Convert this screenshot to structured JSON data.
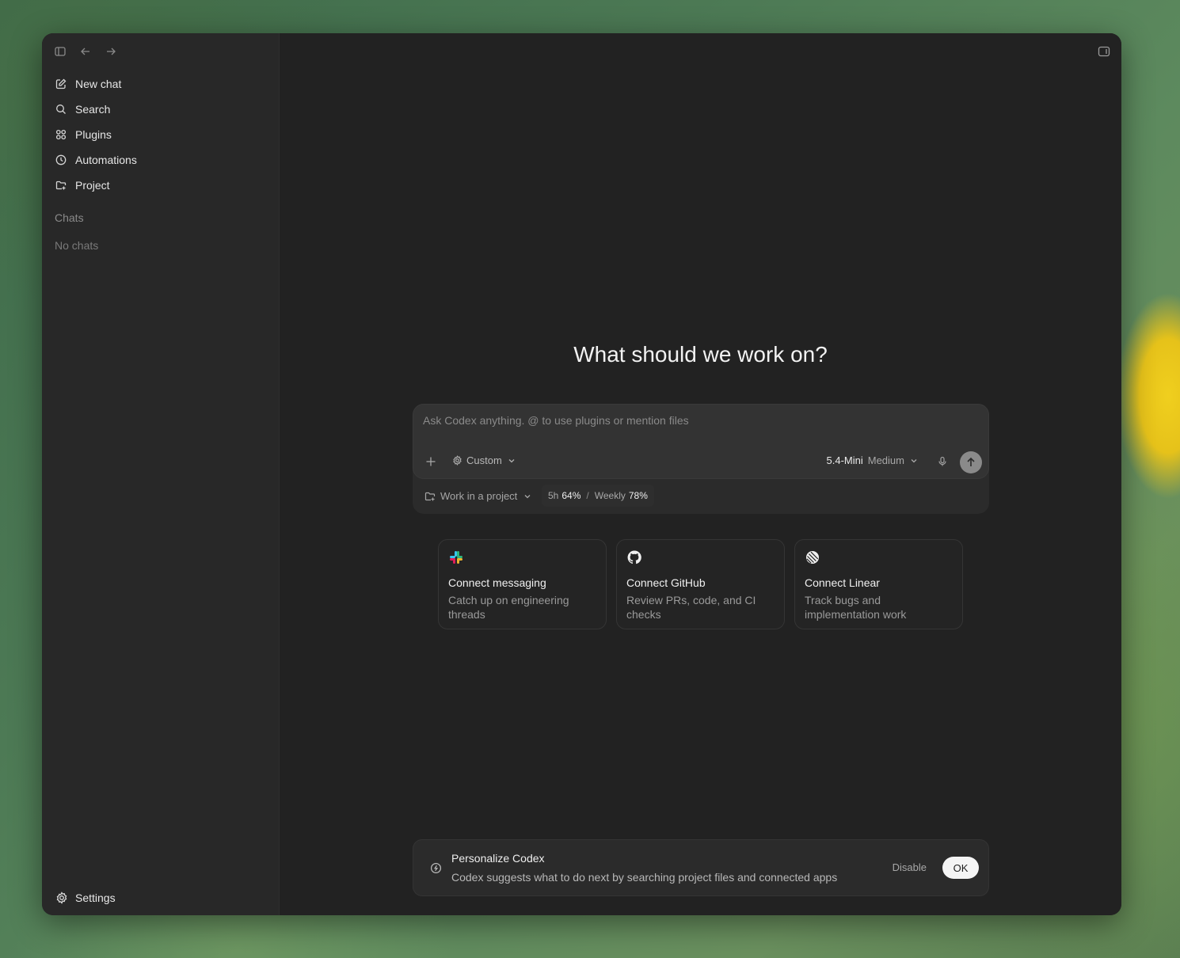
{
  "sidebar": {
    "nav": [
      {
        "label": "New chat",
        "icon": "new-chat-icon"
      },
      {
        "label": "Search",
        "icon": "search-icon"
      },
      {
        "label": "Plugins",
        "icon": "plugins-icon"
      },
      {
        "label": "Automations",
        "icon": "clock-icon"
      },
      {
        "label": "Project",
        "icon": "folder-icon"
      }
    ],
    "chats_label": "Chats",
    "chats_empty": "No chats",
    "settings_label": "Settings"
  },
  "main": {
    "heading": "What should we work on?",
    "composer": {
      "placeholder": "Ask Codex anything. @ to use plugins or mention files",
      "mode": "Custom",
      "model": "5.4-Mini",
      "effort": "Medium",
      "project": "Work in a project",
      "usage": {
        "h_label": "5h",
        "h_value": "64%",
        "sep": "/",
        "w_label": "Weekly",
        "w_value": "78%"
      }
    },
    "cards": [
      {
        "title": "Connect messaging",
        "desc": "Catch up on engineering threads",
        "icon": "slack-icon"
      },
      {
        "title": "Connect GitHub",
        "desc": "Review PRs, code, and CI checks",
        "icon": "github-icon"
      },
      {
        "title": "Connect Linear",
        "desc": "Track bugs and implementation work",
        "icon": "linear-icon"
      }
    ],
    "banner": {
      "title": "Personalize Codex",
      "desc": "Codex suggests what to do next by searching project files and connected apps",
      "disable_label": "Disable",
      "ok_label": "OK"
    }
  },
  "colors": {
    "slack_red": "#e01e5a",
    "slack_blue": "#36c5f0",
    "slack_green": "#2eb67d",
    "slack_yellow": "#ecb22e"
  }
}
